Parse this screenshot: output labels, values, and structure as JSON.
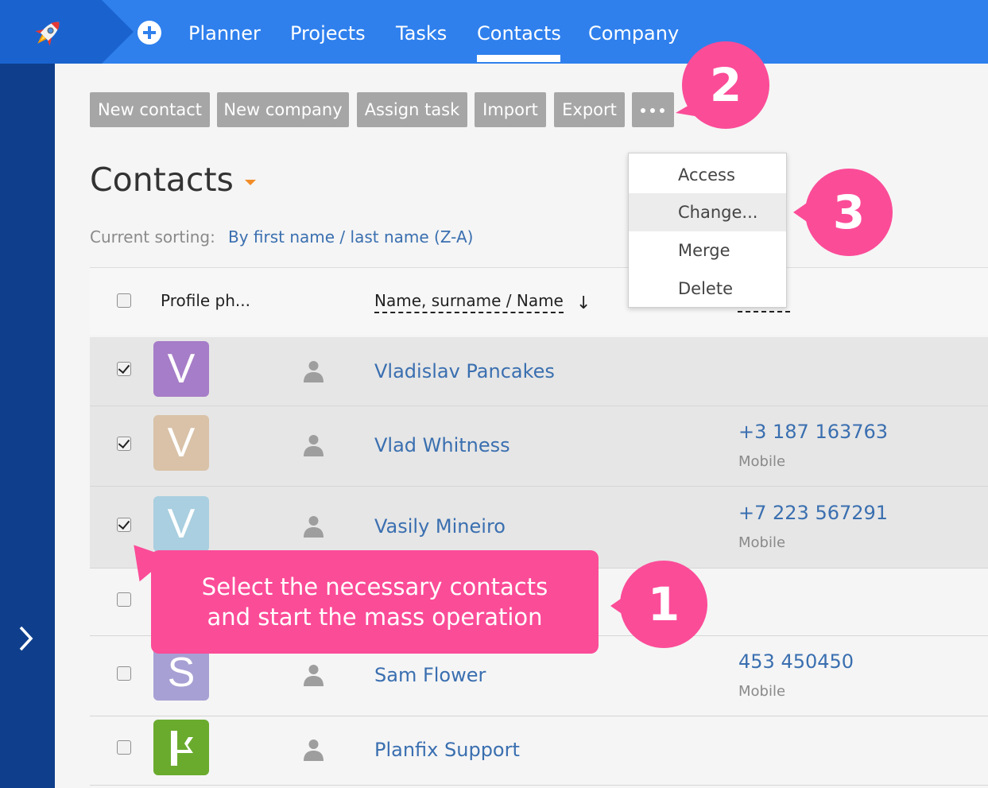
{
  "nav": {
    "items": [
      "Planner",
      "Projects",
      "Tasks",
      "Contacts",
      "Company"
    ],
    "active": "Contacts"
  },
  "toolbar": {
    "buttons": [
      "New contact",
      "New company",
      "Assign task",
      "Import",
      "Export"
    ],
    "more_icon": "more-dots-icon"
  },
  "page": {
    "title": "Contacts",
    "sorting_label": "Current sorting:",
    "sorting_value": "By first name / last name (Z-A)"
  },
  "table": {
    "headers": {
      "photo": "Profile ph...",
      "name": "Name, surname / Name",
      "sort_arrow": "↓"
    },
    "rows": [
      {
        "initial": "V",
        "color": "#a67dc8",
        "name": "Vladislav Pancakes",
        "phone": "",
        "phone_type": "",
        "selected": true
      },
      {
        "initial": "V",
        "color": "#d9c2a8",
        "name": "Vlad Whitness",
        "phone": "+3 187 163763",
        "phone_type": "Mobile",
        "selected": true
      },
      {
        "initial": "V",
        "color": "#a9cfe0",
        "name": "Vasily Mineiro",
        "phone": "+7 223 567291",
        "phone_type": "Mobile",
        "selected": true
      },
      {
        "initial": "",
        "color": "",
        "name": "",
        "phone": "",
        "phone_type": "",
        "selected": false
      },
      {
        "initial": "S",
        "color": "#a7a0d4",
        "name": "Sam Flower",
        "phone": "453 450450",
        "phone_type": "Mobile",
        "selected": false
      },
      {
        "initial": "",
        "color": "#6aab2e",
        "name": "Planfix Support",
        "phone": "",
        "phone_type": "",
        "selected": false
      }
    ]
  },
  "dropdown": {
    "items": [
      "Access",
      "Change...",
      "Merge",
      "Delete"
    ],
    "highlighted": "Change..."
  },
  "callouts": {
    "step1": "1",
    "step2": "2",
    "step3": "3",
    "tooltip_line1": "Select the necessary contacts",
    "tooltip_line2": "and start the mass operation"
  },
  "colors": {
    "topbar": "#2f80ed",
    "sidebar": "#0f3f8c",
    "accent_pink": "#fb4c98",
    "link_blue": "#3a6fb0"
  }
}
